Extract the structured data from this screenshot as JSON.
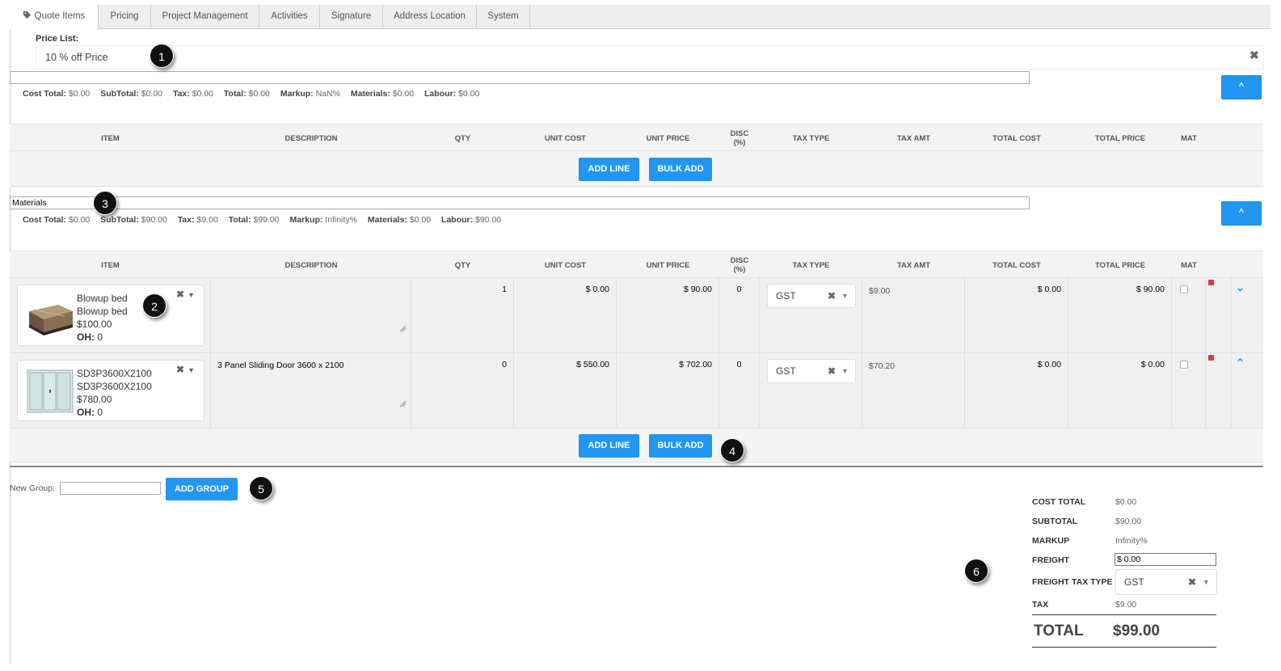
{
  "tabs": [
    {
      "label": "Quote Items",
      "active": true
    },
    {
      "label": "Pricing"
    },
    {
      "label": "Project Management"
    },
    {
      "label": "Activities"
    },
    {
      "label": "Signature"
    },
    {
      "label": "Address Location"
    },
    {
      "label": "System"
    }
  ],
  "price_list": {
    "label": "Price List:",
    "value": "10 % off Price",
    "clear_icon": "✖"
  },
  "columns": {
    "item": "ITEM",
    "description": "DESCRIPTION",
    "qty": "QTY",
    "unit_cost": "UNIT COST",
    "unit_price": "UNIT PRICE",
    "disc": "DISC\n(%)",
    "tax_type": "TAX TYPE",
    "tax_amt": "TAX AMT",
    "total_cost": "TOTAL COST",
    "total_price": "TOTAL PRICE",
    "mat": "MAT"
  },
  "group1": {
    "name": "",
    "summary": {
      "cost_total_label": "Cost Total:",
      "cost_total": "$0.00",
      "subtotal_label": "SubTotal:",
      "subtotal": "$0.00",
      "tax_label": "Tax:",
      "tax": "$0.00",
      "total_label": "Total:",
      "total": "$0.00",
      "markup_label": "Markup:",
      "markup": "NaN%",
      "materials_label": "Materials:",
      "materials": "$0.00",
      "labour_label": "Labour:",
      "labour": "$0.00"
    },
    "collapse_label": "^",
    "add_line": "ADD LINE",
    "bulk_add": "BULK ADD"
  },
  "group2": {
    "name": "Materials",
    "summary": {
      "cost_total_label": "Cost Total:",
      "cost_total": "$0.00",
      "subtotal_label": "SubTotal:",
      "subtotal": "$90.00",
      "tax_label": "Tax:",
      "tax": "$9.00",
      "total_label": "Total:",
      "total": "$99.00",
      "markup_label": "Markup:",
      "markup": "Infinity%",
      "materials_label": "Materials:",
      "materials": "$0.00",
      "labour_label": "Labour:",
      "labour": "$90.00"
    },
    "collapse_label": "^",
    "add_line": "ADD LINE",
    "bulk_add": "BULK ADD",
    "rows": [
      {
        "name": "Blowup bed",
        "sku": "Blowup bed",
        "price": "$100.00",
        "oh_label": "OH:",
        "oh": "0",
        "description": "",
        "qty": "1",
        "unit_cost": "$ 0.00",
        "unit_price": "$ 90.00",
        "disc": "0",
        "tax_type": "GST",
        "tax_amt": "$9.00",
        "total_cost": "$ 0.00",
        "total_price": "$ 90.00",
        "move_icon": "chevron-down-icon",
        "move_glyph": "⌄"
      },
      {
        "name": "SD3P3600X2100",
        "sku": "SD3P3600X2100",
        "price": "$780.00",
        "oh_label": "OH:",
        "oh": "0",
        "description": "3 Panel Sliding Door 3600 x 2100",
        "qty": "0",
        "unit_cost": "$ 550.00",
        "unit_price": "$ 702.00",
        "disc": "0",
        "tax_type": "GST",
        "tax_amt": "$70.20",
        "total_cost": "$ 0.00",
        "total_price": "$ 0.00",
        "move_icon": "chevron-up-icon",
        "move_glyph": "⌃"
      }
    ]
  },
  "new_group": {
    "label": "New Group:",
    "value": "",
    "button": "ADD GROUP"
  },
  "totals": {
    "cost_total_label": "COST TOTAL",
    "cost_total": "$0.00",
    "subtotal_label": "SUBTOTAL",
    "subtotal": "$90.00",
    "markup_label": "MARKUP",
    "markup": "Infinity%",
    "freight_label": "FREIGHT",
    "freight": "$ 0.00",
    "freight_tax_type_label": "FREIGHT TAX TYPE",
    "freight_tax_type": "GST",
    "tax_label": "TAX",
    "tax": "$9.00",
    "total_label": "TOTAL",
    "total": "$99.00"
  },
  "callouts": [
    "1",
    "2",
    "3",
    "4",
    "5",
    "6"
  ],
  "colors": {
    "accent": "#2196f3",
    "callout": "#111111",
    "delete": "#e53935"
  }
}
